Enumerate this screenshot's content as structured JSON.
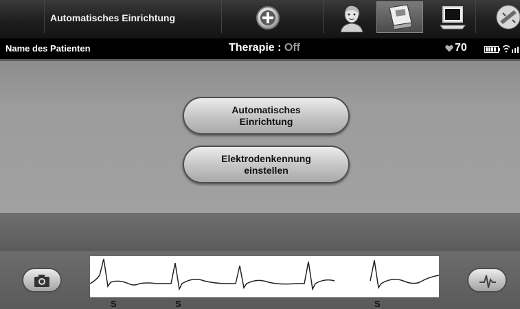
{
  "header": {
    "title": "Automatisches Einrichtung",
    "add_icon": "plus-icon",
    "tools": [
      "patient-icon",
      "programmer-icon",
      "monitor-icon",
      "wand-icon"
    ]
  },
  "status": {
    "patient_label": "Name des Patienten",
    "therapy_label": "Therapie : ",
    "therapy_value": "Off",
    "heart_rate": "70"
  },
  "menu": {
    "buttons": [
      {
        "label": "Automatisches\nEinrichtung"
      },
      {
        "label": "Elektrodenkennung\neinstellen"
      }
    ]
  },
  "ecg": {
    "beat_labels": [
      "S",
      "S",
      "S"
    ]
  },
  "colors": {
    "panel": "#9c9c9c",
    "button": "#c4c4c4",
    "statusbar": "#000000",
    "therapy_value": "#9a9a9a"
  }
}
